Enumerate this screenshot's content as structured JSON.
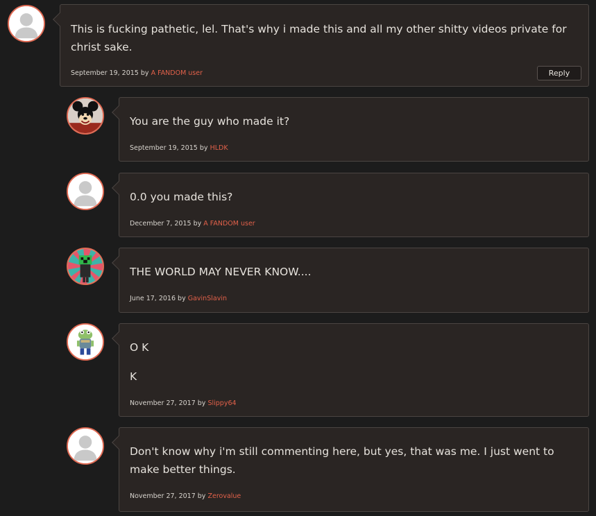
{
  "comments": [
    {
      "text": "This is fucking pathetic, lel. That's why i made this and all my other shitty videos private for christ sake.",
      "date": "September 19, 2015",
      "by": "by",
      "user": "A FANDOM user",
      "avatar": "default-avatar-icon",
      "reply_label": "Reply"
    },
    {
      "text": "You are the guy who made it?",
      "date": "September 19, 2015",
      "by": "by",
      "user": "HLDK",
      "avatar": "mickey-mouse-avatar"
    },
    {
      "text": "0.0 you made this?",
      "date": "December 7, 2015",
      "by": "by",
      "user": "A FANDOM user",
      "avatar": "default-avatar-icon"
    },
    {
      "text": "THE WORLD MAY NEVER KNOW....",
      "date": "June 17, 2016",
      "by": "by",
      "user": "GavinSlavin",
      "avatar": "creeper-avatar"
    },
    {
      "text_lines": [
        "O K",
        "K"
      ],
      "date": "November 27, 2017",
      "by": "by",
      "user": "Slippy64",
      "avatar": "slippy-toad-avatar"
    },
    {
      "text": "Don't know why i'm still commenting here, but yes, that was me. I just went to make better things.",
      "date": "November 27, 2017",
      "by": "by",
      "user": "Zerovalue",
      "avatar": "default-avatar-icon"
    }
  ],
  "colors": {
    "background": "#1c1c1c",
    "box": "#2a2523",
    "accent": "#e2614a",
    "avatar_border": "#e06a53"
  }
}
